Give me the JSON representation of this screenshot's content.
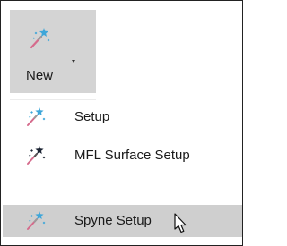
{
  "new_button": {
    "label": "New",
    "icon": "magic-wand-icon",
    "dropdown_icon": "chevron-down-icon"
  },
  "menu": {
    "items": [
      {
        "label": "Setup",
        "icon": "magic-wand-icon",
        "variant": "light"
      },
      {
        "label": "MFL Surface Setup",
        "icon": "magic-wand-icon",
        "variant": "dark"
      },
      {
        "label": "Spyne Setup",
        "icon": "magic-wand-icon",
        "variant": "light",
        "highlighted": true
      }
    ]
  },
  "colors": {
    "button_background": "#d4d4d4",
    "highlight_background": "#cfcfcf",
    "wand_blue": "#3ea6d9",
    "wand_dark": "#1c2433",
    "wand_pink": "#d56b8c",
    "frame_border": "#222222"
  }
}
